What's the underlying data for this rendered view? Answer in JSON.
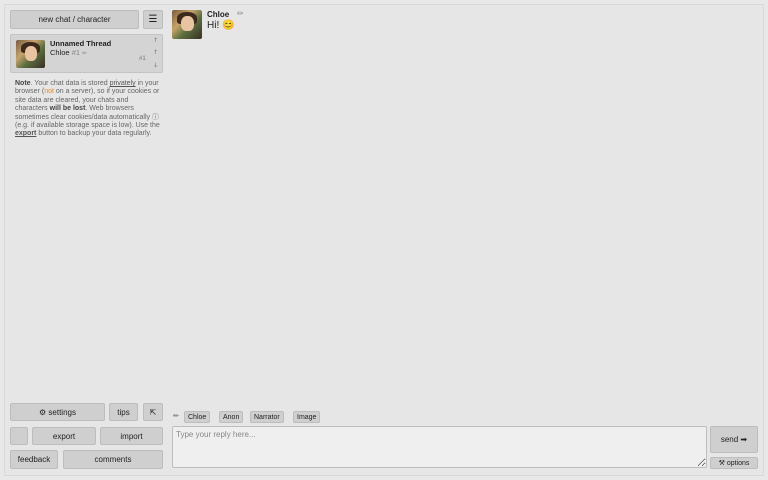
{
  "sidebar": {
    "new_chat_label": "new chat / character",
    "new_chat_icon": "",
    "menu_icon": "☰",
    "thread": {
      "title": "Unnamed Thread",
      "character": "Chloe",
      "num": "#1",
      "edit_icon": "✏",
      "up_icon": "↑",
      "down_icon": "↓",
      "mid_icon": "↑",
      "count": "#1"
    },
    "note": {
      "p1": "Note",
      "p2": ". Your chat data is stored ",
      "p3": "privately",
      "p4": " in your browser (",
      "p5": "not",
      "p6": " on a server), so if your cookies or site data are cleared, your chats and characters ",
      "p7": "will be lost",
      "p8": ". Web browsers sometimes clear cookies/data automatically ⓘ (e.g. if available storage space is low). Use the ",
      "p9": "export",
      "p10": " button to backup your data regularly."
    },
    "bottom": {
      "settings": "⚙ settings",
      "tips": " tips",
      "collapse": "⇱",
      "icon_btn": "",
      "export": " export",
      "import": " import",
      "feedback": " feedback",
      "comments": " comments"
    }
  },
  "chat": {
    "messages": [
      {
        "author": "Chloe",
        "text": "Hi! 😊",
        "edit_icon": "✏",
        "tool2": "",
        "tool3": ""
      }
    ],
    "quick_reply": {
      "pencil_icon": "✏",
      "buttons": [
        " Chloe",
        " Anon",
        " Narrator",
        " Image"
      ]
    },
    "input": {
      "placeholder": "Type your reply here...",
      "value": ""
    },
    "send_label": "send ➡",
    "options_label": "⚒ options"
  }
}
